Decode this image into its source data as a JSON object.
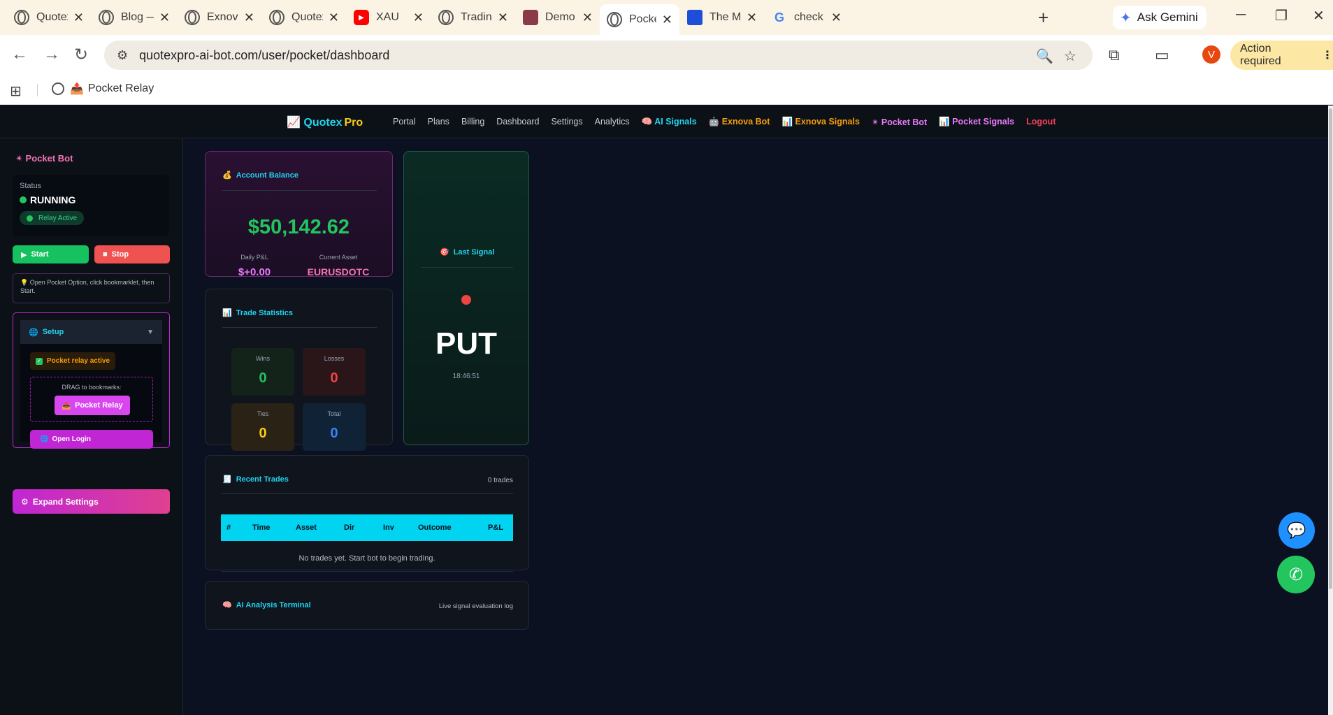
{
  "browser": {
    "tabs": [
      {
        "title": "Quotex P",
        "icon": "globe-icon"
      },
      {
        "title": "Blog — C",
        "icon": "globe-icon"
      },
      {
        "title": "Exnova T",
        "icon": "globe-icon"
      },
      {
        "title": "Quotex P",
        "icon": "globe-icon"
      },
      {
        "title": "XAU",
        "icon": "youtube-icon"
      },
      {
        "title": "Trading",
        "icon": "globe-icon"
      },
      {
        "title": "Demo tr",
        "icon": "hex-icon"
      },
      {
        "title": "Pocket C",
        "icon": "globe-icon",
        "active": true
      },
      {
        "title": "The Mos",
        "icon": "flag-icon"
      },
      {
        "title": "check in",
        "icon": "google-icon"
      }
    ],
    "ask_gemini": "Ask Gemini",
    "url": "quotexpro-ai-bot.com/user/pocket/dashboard",
    "profile_initial": "V",
    "action_required": "Action required",
    "bookmark": "Pocket Relay"
  },
  "nav": {
    "brand": "Quotex",
    "brand_pro": "Pro",
    "links": [
      {
        "label": "Portal",
        "style": "plain"
      },
      {
        "label": "Plans",
        "style": "plain"
      },
      {
        "label": "Billing",
        "style": "plain"
      },
      {
        "label": "Dashboard",
        "style": "plain"
      },
      {
        "label": "Settings",
        "style": "plain"
      },
      {
        "label": "Analytics",
        "style": "plain"
      },
      {
        "label": "🧠 AI Signals",
        "style": "cyan"
      },
      {
        "label": "🤖 Exnova Bot",
        "style": "orange"
      },
      {
        "label": "📊 Exnova Signals",
        "style": "orange"
      },
      {
        "label": "✴ Pocket Bot",
        "style": "pink"
      },
      {
        "label": "📊 Pocket Signals",
        "style": "pink"
      },
      {
        "label": "Logout",
        "style": "red"
      }
    ]
  },
  "sidebar": {
    "title": "Pocket Bot",
    "status_label": "Status",
    "status_value": "RUNNING",
    "relay_pill": "Relay Active",
    "start_label": "Start",
    "stop_label": "Stop",
    "tip": "Open Pocket Option, click bookmarklet, then Start.",
    "setup_label": "Setup",
    "relay_active": "Pocket relay active",
    "drag_label": "DRAG to bookmarks:",
    "relay_button": "Pocket Relay",
    "open_login": "Open Login",
    "expand_settings": "Expand Settings"
  },
  "balance": {
    "title": "Account Balance",
    "amount": "$50,142.62",
    "daily_pnl_label": "Daily P&L",
    "daily_pnl": "$+0.00",
    "asset_label": "Current Asset",
    "asset": "EURUSDOTC"
  },
  "stats": {
    "title": "Trade Statistics",
    "wins_label": "Wins",
    "wins": "0",
    "losses_label": "Losses",
    "losses": "0",
    "ties_label": "Ties",
    "ties": "0",
    "total_label": "Total",
    "total": "0"
  },
  "signal": {
    "title": "Last Signal",
    "direction": "PUT",
    "time": "18:46:51"
  },
  "trades": {
    "title": "Recent Trades",
    "count": "0 trades",
    "columns": [
      "#",
      "Time",
      "Asset",
      "Dir",
      "Inv",
      "Outcome",
      "P&L"
    ],
    "empty": "No trades yet. Start bot to begin trading."
  },
  "ai": {
    "title": "AI Analysis Terminal",
    "subtitle": "Live signal evaluation log"
  },
  "colors": {
    "accent_cyan": "#22d3ee",
    "accent_pink": "#e879f9",
    "win_green": "#22c55e",
    "loss_red": "#ef4444",
    "tie_yellow": "#facc15",
    "total_blue": "#3b82f6"
  }
}
